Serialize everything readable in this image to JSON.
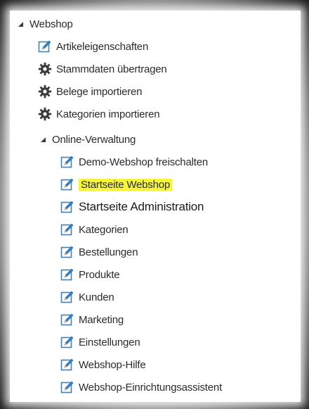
{
  "tree": {
    "root": {
      "label": "Webshop",
      "expanded": true
    },
    "items": [
      {
        "label": "Artikeleigenschaften",
        "icon": "edit-icon"
      },
      {
        "label": "Stammdaten übertragen",
        "icon": "gear-icon"
      },
      {
        "label": "Belege importieren",
        "icon": "gear-icon"
      },
      {
        "label": "Kategorien importieren",
        "icon": "gear-icon"
      }
    ],
    "online": {
      "label": "Online-Verwaltung",
      "expanded": true,
      "items": [
        {
          "label": "Demo-Webshop freischalten",
          "icon": "edit-icon"
        },
        {
          "label": "Startseite Webshop",
          "icon": "edit-icon",
          "highlighted": true
        },
        {
          "label": "Startseite Administration",
          "icon": "edit-icon"
        },
        {
          "label": "Kategorien",
          "icon": "edit-icon"
        },
        {
          "label": "Bestellungen",
          "icon": "edit-icon"
        },
        {
          "label": "Produkte",
          "icon": "edit-icon"
        },
        {
          "label": "Kunden",
          "icon": "edit-icon"
        },
        {
          "label": "Marketing",
          "icon": "edit-icon"
        },
        {
          "label": "Einstellungen",
          "icon": "edit-icon"
        },
        {
          "label": "Webshop-Hilfe",
          "icon": "edit-icon"
        },
        {
          "label": "Webshop-Einrichtungsassistent",
          "icon": "edit-icon"
        }
      ]
    }
  },
  "colors": {
    "highlight": "#f6f53b",
    "icon_blue": "#2f86d6",
    "text": "#2b2b2b"
  }
}
